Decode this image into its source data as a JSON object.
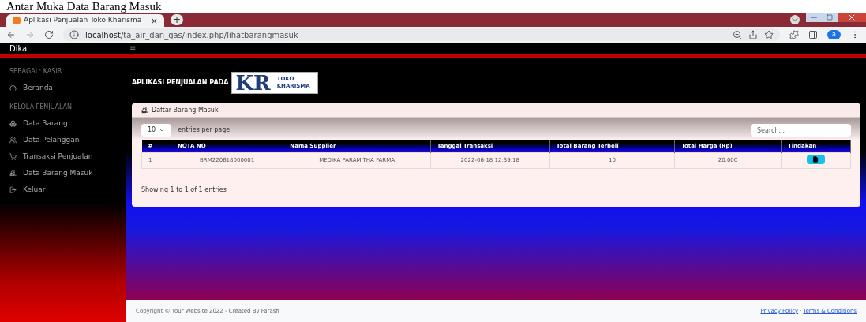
{
  "caption": "Antar Muka Data Barang Masuk",
  "browser": {
    "tab_title": "Aplikasi Penjualan Toko Kharisma",
    "tab_close": "×",
    "new_tab": "+",
    "url_host": "localhost",
    "url_path": "/ta_air_dan_gas/index.php/lihatbarangmasuk",
    "profile": "a"
  },
  "navbar": {
    "brand": "Dika",
    "menu": "≡"
  },
  "sidebar": {
    "sections": [
      {
        "heading": "SEBAGAI : KASIR",
        "items": [
          {
            "label": "Beranda",
            "kind": "gauge"
          }
        ]
      },
      {
        "heading": "KELOLA PENJUALAN",
        "items": [
          {
            "label": "Data Barang",
            "kind": "boxes"
          },
          {
            "label": "Data Pelanggan",
            "kind": "users"
          },
          {
            "label": "Transaksi Penjualan",
            "kind": "cart"
          },
          {
            "label": "Data Barang Masuk",
            "kind": "dolly"
          },
          {
            "label": "Keluar",
            "kind": "logout"
          }
        ]
      }
    ]
  },
  "header": {
    "title": "APLIKASI PENJUALAN PADA",
    "logo_mark": "KR",
    "logo_line1": "TOKO",
    "logo_line2": "KHARISMA"
  },
  "card": {
    "title": "Daftar Barang Masuk",
    "per_page": "10",
    "per_page_label": "entries per page",
    "search_placeholder": "Search...",
    "table": {
      "columns": [
        "#",
        "NOTA NO",
        "Nama Supplier",
        "Tanggal Transaksi",
        "Total Barang Terbeli",
        "Total Harga (Rp)",
        "Tindakan"
      ],
      "rows": [
        {
          "cells": [
            "1",
            "BRM220618000001",
            "MEDIKA PARAMITHA FARMA",
            "2022-06-18 12:39:18",
            "10",
            "20.000"
          ]
        }
      ]
    },
    "info": "Showing 1 to 1 of 1 entries"
  },
  "footer": {
    "copyright": "Copyright © Your Website 2022 - Created By Farash",
    "links": [
      "Privacy Policy",
      "Terms & Conditions"
    ],
    "separator": "·"
  }
}
